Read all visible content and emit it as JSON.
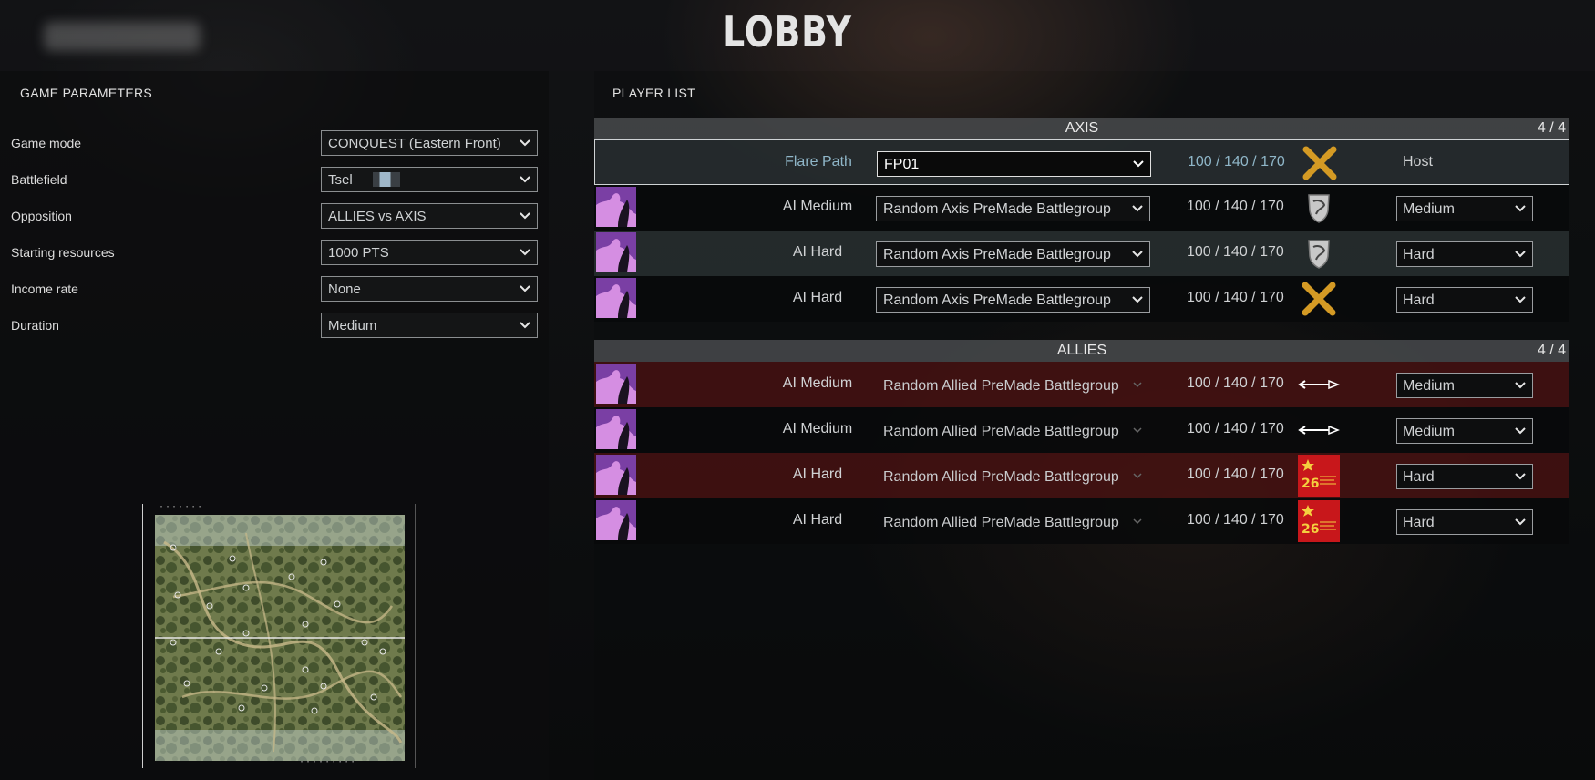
{
  "header": {
    "title": "LOBBY"
  },
  "params": {
    "title": "GAME PARAMETERS",
    "rows": [
      {
        "label": "Game mode",
        "value": "CONQUEST (Eastern Front)"
      },
      {
        "label": "Battlefield",
        "value": "Tsel"
      },
      {
        "label": "Opposition",
        "value": "ALLIES vs AXIS"
      },
      {
        "label": "Starting resources",
        "value": "1000 PTS"
      },
      {
        "label": "Income rate",
        "value": "None"
      },
      {
        "label": "Duration",
        "value": "Medium"
      }
    ]
  },
  "players": {
    "title": "PLAYER LIST",
    "axis": {
      "name": "AXIS",
      "count": "4 / 4",
      "rows": [
        {
          "name": "Flare Path",
          "battlegroup": "FP01",
          "resources": "100 / 140 / 170",
          "icon": "crossed-swords-icon",
          "role": "Host"
        },
        {
          "name": "AI Medium",
          "battlegroup": "Random Axis PreMade Battlegroup",
          "resources": "100 / 140 / 170",
          "icon": "shield-emblem-icon",
          "difficulty": "Medium"
        },
        {
          "name": "AI Hard",
          "battlegroup": "Random Axis PreMade Battlegroup",
          "resources": "100 / 140 / 170",
          "icon": "shield-emblem-icon",
          "difficulty": "Hard"
        },
        {
          "name": "AI Hard",
          "battlegroup": "Random Axis PreMade Battlegroup",
          "resources": "100 / 140 / 170",
          "icon": "crossed-swords-icon",
          "difficulty": "Hard"
        }
      ]
    },
    "allies": {
      "name": "ALLIES",
      "count": "4 / 4",
      "rows": [
        {
          "name": "AI Medium",
          "battlegroup": "Random Allied PreMade Battlegroup",
          "resources": "100 / 140 / 170",
          "icon": "arrow-emblem-icon",
          "difficulty": "Medium"
        },
        {
          "name": "AI Medium",
          "battlegroup": "Random Allied PreMade Battlegroup",
          "resources": "100 / 140 / 170",
          "icon": "arrow-emblem-icon",
          "difficulty": "Medium"
        },
        {
          "name": "AI Hard",
          "battlegroup": "Random Allied PreMade Battlegroup",
          "resources": "100 / 140 / 170",
          "icon": "red-star-banner-icon",
          "difficulty": "Hard"
        },
        {
          "name": "AI Hard",
          "battlegroup": "Random Allied PreMade Battlegroup",
          "resources": "100 / 140 / 170",
          "icon": "red-star-banner-icon",
          "difficulty": "Hard"
        }
      ]
    }
  },
  "colors": {
    "selected_text": "#8fb6c8",
    "allied_row_red": "#461212",
    "swords_gold": "#d49a24",
    "banner_red": "#c8171b"
  }
}
